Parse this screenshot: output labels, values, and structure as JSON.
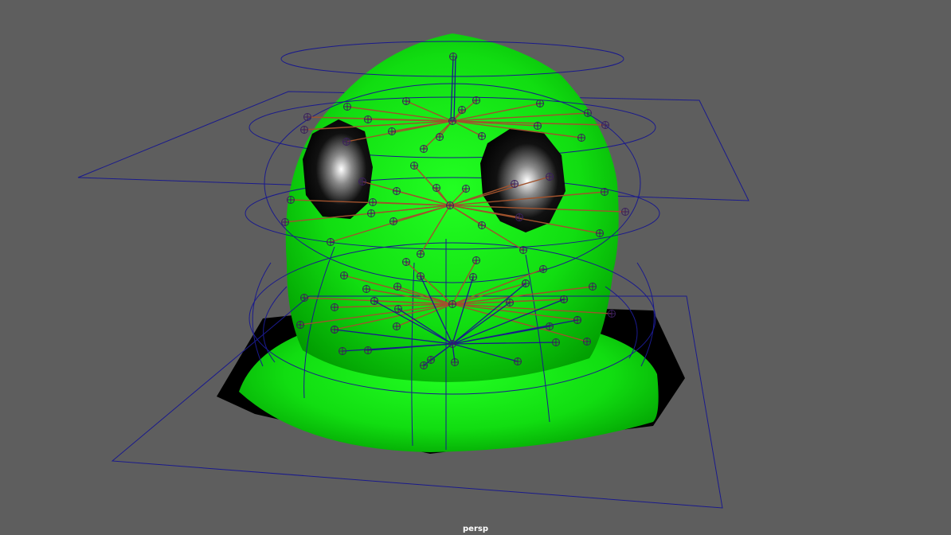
{
  "viewport": {
    "camera_name": "persp",
    "background_color": "#5e5e5e",
    "mesh_color": "#00cc00",
    "wire_color": "#1a1a8c",
    "joint_color": "#a0522d",
    "locator_color": "#3a1f5c"
  }
}
